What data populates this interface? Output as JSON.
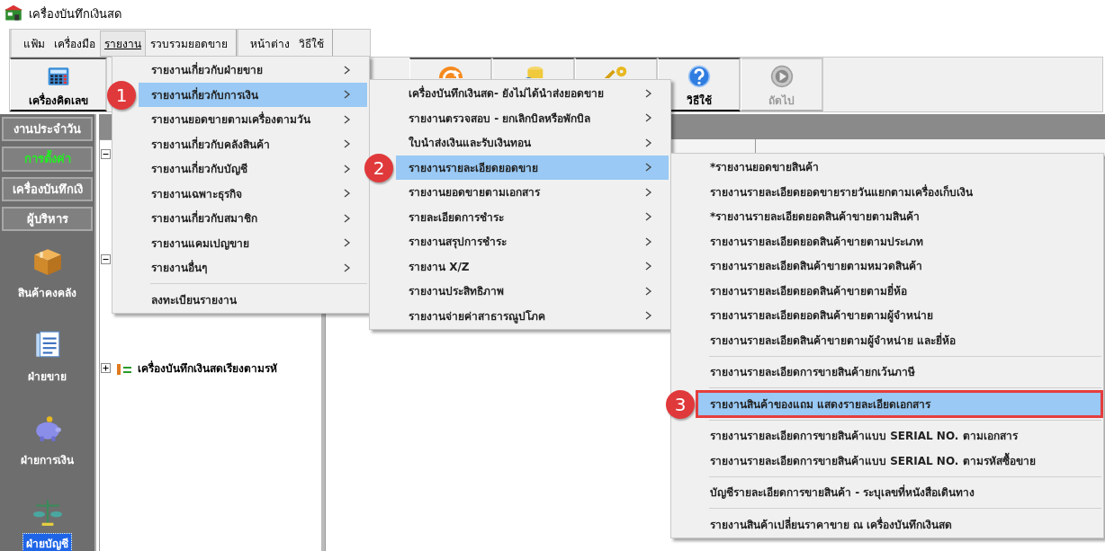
{
  "window": {
    "title": "เครื่องบันทึกเงินสด"
  },
  "menu_groups": [
    [
      {
        "label": "แฟ้ม",
        "selected": false
      },
      {
        "label": "เครื่องมือ",
        "selected": false
      },
      {
        "label": "รายงาน",
        "selected": true
      },
      {
        "label": "รวบรวมยอดขาย",
        "selected": false
      }
    ],
    [
      {
        "label": "หน้าต่าง",
        "selected": false
      },
      {
        "label": "วิธีใช้",
        "selected": false
      }
    ]
  ],
  "toolbar": [
    {
      "kind": "calculator",
      "label": "เครื่องคิดเลข",
      "disabled": false
    },
    {
      "kind": "gap"
    },
    {
      "kind": "refresh",
      "disabled": false
    },
    {
      "kind": "database",
      "disabled": false
    },
    {
      "kind": "key",
      "disabled": false
    },
    {
      "kind": "help",
      "label": "วิธีใช้",
      "disabled": false
    },
    {
      "kind": "next",
      "label": "ถัดไป",
      "disabled": true
    }
  ],
  "sidebar": {
    "sections": [
      {
        "label": "งานประจำวัน",
        "selected": false
      },
      {
        "label": "การตั้งค่า",
        "selected": true
      },
      {
        "label": "เครื่องบันทึกเงิ",
        "selected": false
      },
      {
        "label": "ผู้บริหาร",
        "selected": false
      }
    ],
    "modules": [
      {
        "kind": "box",
        "label": "สินค้าคงคลัง",
        "selected": false
      },
      {
        "kind": "document",
        "label": "ฝ่ายขาย",
        "selected": false
      },
      {
        "kind": "piggy",
        "label": "ฝ่ายการเงิน",
        "selected": false
      },
      {
        "kind": "scale",
        "label": "ฝ่ายบัญชี",
        "selected": true
      }
    ]
  },
  "tree": {
    "items": [
      {
        "expanded": true
      },
      {
        "expanded": true
      },
      {
        "expanded": false,
        "label": "เครื่องบันทึกเงินสดเรียงตามรหั"
      }
    ]
  },
  "menus": [
    {
      "items": [
        {
          "kind": "item",
          "label": "รายงานเกี่ยวกับฝ่ายขาย",
          "submenu": true,
          "selected": false
        },
        {
          "kind": "item",
          "label": "รายงานเกี่ยวกับการเงิน",
          "submenu": true,
          "selected": true,
          "callout": "1"
        },
        {
          "kind": "item",
          "label": "รายงานยอดขายตามเครื่องตามวัน",
          "submenu": true,
          "selected": false
        },
        {
          "kind": "item",
          "label": "รายงานเกี่ยวกับคลังสินค้า",
          "submenu": true,
          "selected": false
        },
        {
          "kind": "item",
          "label": "รายงานเกี่ยวกับบัญชี",
          "submenu": true,
          "selected": false
        },
        {
          "kind": "item",
          "label": "รายงานเฉพาะธุรกิจ",
          "submenu": true,
          "selected": false
        },
        {
          "kind": "item",
          "label": "รายงานเกี่ยวกับสมาชิก",
          "submenu": true,
          "selected": false
        },
        {
          "kind": "item",
          "label": "รายงานแคมเปญขาย",
          "submenu": true,
          "selected": false
        },
        {
          "kind": "item",
          "label": "รายงานอื่นๆ",
          "submenu": true,
          "selected": false
        },
        {
          "kind": "separator"
        },
        {
          "kind": "item",
          "label": "ลงทะเบียนรายงาน",
          "submenu": false,
          "selected": false
        }
      ]
    },
    {
      "items": [
        {
          "kind": "item",
          "label": "เครื่องบันทึกเงินสด- ยังไม่ได้นำส่งยอดขาย",
          "submenu": true,
          "selected": false
        },
        {
          "kind": "item",
          "label": "รายงานตรวจสอบ - ยกเลิกบิลหรือพักบิล",
          "submenu": true,
          "selected": false
        },
        {
          "kind": "item",
          "label": "ใบนำส่งเงินและรับเงินทอน",
          "submenu": true,
          "selected": false
        },
        {
          "kind": "item",
          "label": "รายงานรายละเอียดยอดขาย",
          "submenu": true,
          "selected": true,
          "callout": "2"
        },
        {
          "kind": "item",
          "label": "รายงานยอดขายตามเอกสาร",
          "submenu": true,
          "selected": false
        },
        {
          "kind": "item",
          "label": "รายละเอียดการชำระ",
          "submenu": true,
          "selected": false
        },
        {
          "kind": "item",
          "label": "รายงานสรุปการชำระ",
          "submenu": true,
          "selected": false
        },
        {
          "kind": "item",
          "label": "รายงาน X/Z",
          "submenu": true,
          "selected": false
        },
        {
          "kind": "item",
          "label": "รายงานประสิทธิภาพ",
          "submenu": true,
          "selected": false
        },
        {
          "kind": "item",
          "label": "รายงานจ่ายค่าสาธารณูปโภค",
          "submenu": true,
          "selected": false
        }
      ]
    },
    {
      "items": [
        {
          "kind": "item",
          "label": "*รายงานยอดขายสินค้า",
          "submenu": false,
          "selected": false
        },
        {
          "kind": "item",
          "label": "รายงานรายละเอียดยอดขายรายวันแยกตามเครื่องเก็บเงิน",
          "submenu": false,
          "selected": false
        },
        {
          "kind": "item",
          "label": "*รายงานรายละเอียดยอดสินค้าขายตามสินค้า",
          "submenu": false,
          "selected": false
        },
        {
          "kind": "item",
          "label": "รายงานรายละเอียดยอดสินค้าขายตามประเภท",
          "submenu": false,
          "selected": false
        },
        {
          "kind": "item",
          "label": "รายงานรายละเอียดสินค้าขายตามหมวดสินค้า",
          "submenu": false,
          "selected": false
        },
        {
          "kind": "item",
          "label": "รายงานรายละเอียดยอดสินค้าขายตามยี่ห้อ",
          "submenu": false,
          "selected": false
        },
        {
          "kind": "item",
          "label": "รายงานรายละเอียดยอดสินค้าขายตามผู้จำหน่าย",
          "submenu": false,
          "selected": false
        },
        {
          "kind": "item",
          "label": "รายงานรายละเอียดสินค้าขายตามผู้จำหน่าย และยี่ห้อ",
          "submenu": false,
          "selected": false
        },
        {
          "kind": "separator"
        },
        {
          "kind": "item",
          "label": "รายงานรายละเอียดการขายสินค้ายกเว้นภาษี",
          "submenu": false,
          "selected": false
        },
        {
          "kind": "separator"
        },
        {
          "kind": "item",
          "label": "รายงานสินค้าของแถม แสดงรายละเอียดเอกสาร",
          "submenu": false,
          "selected": true,
          "callout": "3",
          "outlined": true
        },
        {
          "kind": "separator"
        },
        {
          "kind": "item",
          "label": "รายงานรายละเอียดการขายสินค้าแบบ SERIAL NO. ตามเอกสาร",
          "submenu": false,
          "selected": false
        },
        {
          "kind": "item",
          "label": "รายงานรายละเอียดการขายสินค้าแบบ SERIAL NO.  ตามรหัสซื้อขาย",
          "submenu": false,
          "selected": false
        },
        {
          "kind": "separator"
        },
        {
          "kind": "item",
          "label": "บัญชีรายละเอียดการขายสินค้า - ระบุเลขที่หนังสือเดินทาง",
          "submenu": false,
          "selected": false
        },
        {
          "kind": "separator"
        },
        {
          "kind": "item",
          "label": "รายงานสินค้าเปลี่ยนราคาขาย ณ เครื่องบันทึกเงินสด",
          "submenu": false,
          "selected": false
        }
      ]
    }
  ]
}
